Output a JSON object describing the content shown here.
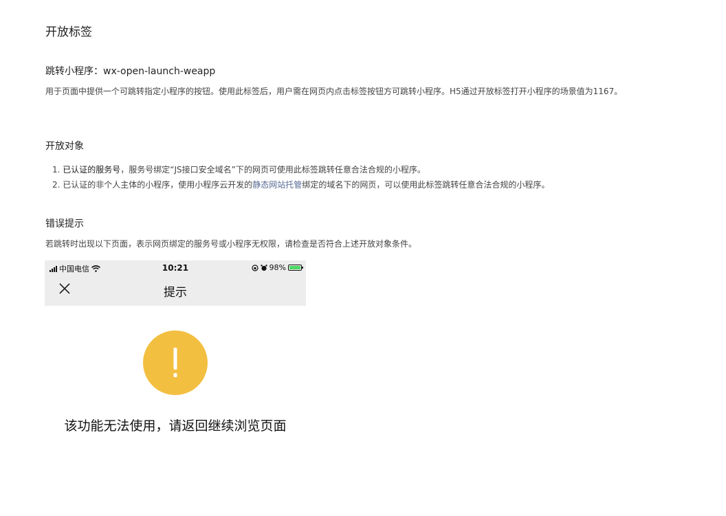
{
  "doc": {
    "title": "开放标签",
    "section1": {
      "heading": "跳转小程序：wx-open-launch-weapp",
      "description": "用于页面中提供一个可跳转指定小程序的按钮。使用此标签后，用户需在网页内点击标签按钮方可跳转小程序。H5通过开放标签打开小程序的场景值为1167。"
    },
    "section2": {
      "heading": "开放对象",
      "items": [
        {
          "num": "1.",
          "strong": "已认证的服务号",
          "text": "，服务号绑定“JS接口安全域名”下的网页可使用此标签跳转任意合法合规的小程序。"
        },
        {
          "num": "2.",
          "pre": "已认证的非个人主体的小程序，使用小程序云开发的",
          "link": "静态网站托管",
          "post": "绑定的域名下的网页，可以使用此标签跳转任意合法合规的小程序。"
        }
      ]
    },
    "section3": {
      "heading": "错误提示",
      "description": "若跳转时出现以下页面，表示网页绑定的服务号或小程序无权限，请检查是否符合上述开放对象条件。"
    }
  },
  "phone": {
    "carrier": "中国电信",
    "time": "10:21",
    "battery": "98%",
    "nav_title": "提示",
    "icons": [
      "signal-icon",
      "wifi-icon",
      "orientation-lock-icon",
      "alarm-icon",
      "battery-icon",
      "close-icon"
    ],
    "warning_text": "该功能无法使用，请返回继续浏览页面",
    "warning_color": "#f3bf41",
    "bar_color": "#ededed"
  },
  "colors": {
    "link": "#576b95",
    "text": "#444444",
    "heading": "#222222"
  }
}
